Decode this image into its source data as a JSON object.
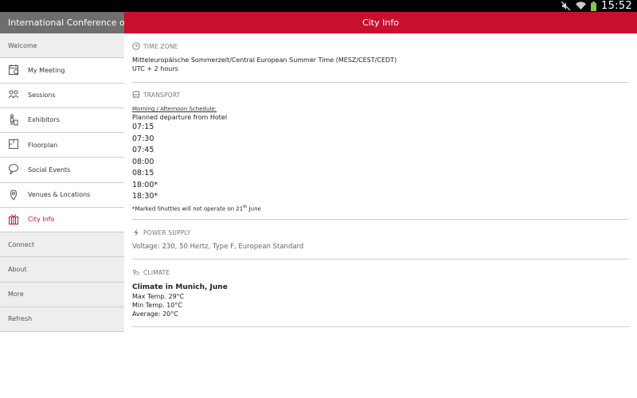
{
  "status_bar": {
    "time": "15:52"
  },
  "sidebar": {
    "title": "International Conference o...",
    "items": [
      {
        "label": "Welcome",
        "type": "section",
        "icon": ""
      },
      {
        "label": "My Meeting",
        "type": "sub",
        "icon": "calendar-icon"
      },
      {
        "label": "Sessions",
        "type": "sub",
        "icon": "people-icon"
      },
      {
        "label": "Exhibitors",
        "type": "sub",
        "icon": "exhibitor-icon"
      },
      {
        "label": "Floorplan",
        "type": "sub",
        "icon": "floorplan-icon"
      },
      {
        "label": "Social Events",
        "type": "sub",
        "icon": "chat-bubble-icon"
      },
      {
        "label": "Venues & Locations",
        "type": "sub",
        "icon": "map-pin-icon"
      },
      {
        "label": "City Info",
        "type": "sub",
        "icon": "gift-icon",
        "active": true
      },
      {
        "label": "Connect",
        "type": "section",
        "icon": ""
      },
      {
        "label": "About",
        "type": "section",
        "icon": ""
      },
      {
        "label": "More",
        "type": "section",
        "icon": ""
      },
      {
        "label": "Refresh",
        "type": "section",
        "icon": ""
      }
    ]
  },
  "header": {
    "title": "City Info"
  },
  "time_zone": {
    "title": "Time Zone",
    "line1": "Mitteleuropäische Sommerzeit/Central European Summer Time (MESZ/CEST/CEDT)",
    "line2": "UTC + 2 hours"
  },
  "transport": {
    "title": "Transport",
    "schedule_label": "Morning / Afternoon Schedule:",
    "departure": "Planned departure from Hotel",
    "times": [
      "07:15",
      "07:30",
      "07:45",
      "08:00",
      "08:15",
      "18:00*",
      "18:30*"
    ],
    "note_prefix": "*Marked Shuttles will not operate on 21",
    "note_sup": "th",
    "note_suffix": " June"
  },
  "power_supply": {
    "title": "Power Supply",
    "text": "Voltage: 230, 50 Hertz, Type F, European Standard"
  },
  "climate": {
    "title": "Climate",
    "heading": "Climate in Munich, June",
    "max": "Max Temp. 29°C",
    "min": "Min Temp. 10°C",
    "avg": "Average: 20°C"
  },
  "colors": {
    "accent": "#c8102e",
    "sidebar_header": "#6e6e6e",
    "section_bg": "#eeeeee"
  }
}
